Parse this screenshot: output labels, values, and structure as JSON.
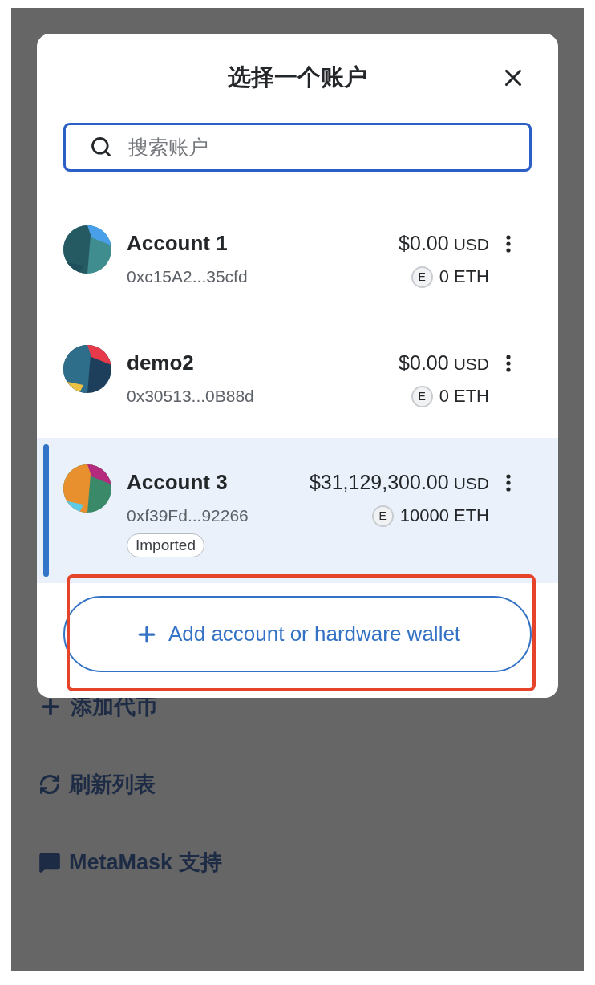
{
  "dialog": {
    "title": "选择一个账户",
    "search": {
      "placeholder": "搜索账户"
    },
    "accounts": [
      {
        "name": "Account 1",
        "address": "0xc15A2...35cfd",
        "fiat": "$0.00",
        "fiat_unit": "USD",
        "token_badge": "E",
        "balance": "0 ETH",
        "selected": false
      },
      {
        "name": "demo2",
        "address": "0x30513...0B88d",
        "fiat": "$0.00",
        "fiat_unit": "USD",
        "token_badge": "E",
        "balance": "0 ETH",
        "selected": false
      },
      {
        "name": "Account 3",
        "address": "0xf39Fd...92266",
        "fiat": "$31,129,300.00",
        "fiat_unit": "USD",
        "token_badge": "E",
        "balance": "10000 ETH",
        "tag": "Imported",
        "selected": true
      }
    ],
    "add_button": {
      "label": "Add account or hardware wallet"
    }
  },
  "background_menu": [
    {
      "kind": "add",
      "label": "添加代币"
    },
    {
      "kind": "refresh",
      "label": "刷新列表"
    },
    {
      "kind": "support",
      "label": "MetaMask 支持"
    }
  ]
}
